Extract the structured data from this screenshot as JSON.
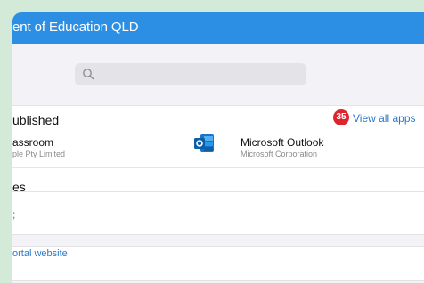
{
  "header": {
    "title": "ent of Education QLD"
  },
  "search": {
    "placeholder": ""
  },
  "apps_section": {
    "title": "ublished",
    "count_badge": "35",
    "view_all_label": "View all apps",
    "apps": [
      {
        "name": "assroom",
        "publisher": "ple Pty Limited"
      },
      {
        "name": "Microsoft Outlook",
        "publisher": "Microsoft Corporation"
      }
    ]
  },
  "mid_section": {
    "title": "es",
    "link": ";"
  },
  "portal": {
    "link": "ortal website"
  },
  "colors": {
    "header": "#2d8fe3",
    "link": "#2b78c8",
    "badge": "#e0242c",
    "background": "#f2f2f7"
  },
  "icons": [
    "search-icon",
    "outlook-icon"
  ]
}
